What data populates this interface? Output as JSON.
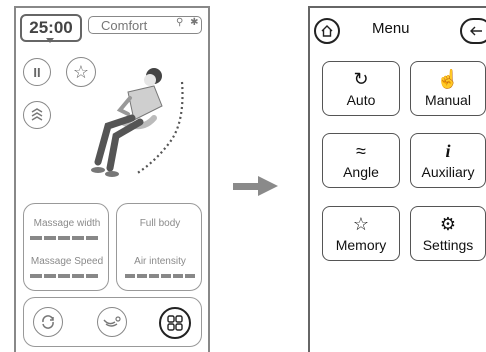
{
  "left": {
    "timer": "25:00",
    "mode": "Comfort",
    "status_icons": "⚲ ✱",
    "pause_glyph": "II",
    "star_glyph": "☆",
    "card1": {
      "label_top": "Massage width",
      "label_bottom": "Massage Speed"
    },
    "card2": {
      "label_top": "Full body",
      "label_bottom": "Air intensity"
    }
  },
  "right": {
    "title": "Menu",
    "tiles": [
      {
        "label": "Auto",
        "icon": "↻"
      },
      {
        "label": "Manual",
        "icon": "☝"
      },
      {
        "label": "Angle",
        "icon": "≈"
      },
      {
        "label": "Auxiliary",
        "icon": "i"
      },
      {
        "label": "Memory",
        "icon": "☆"
      },
      {
        "label": "Settings",
        "icon": "⚙"
      }
    ]
  },
  "colors": {
    "border": "#888888",
    "text": "#111111",
    "muted": "#8a8a8a"
  }
}
